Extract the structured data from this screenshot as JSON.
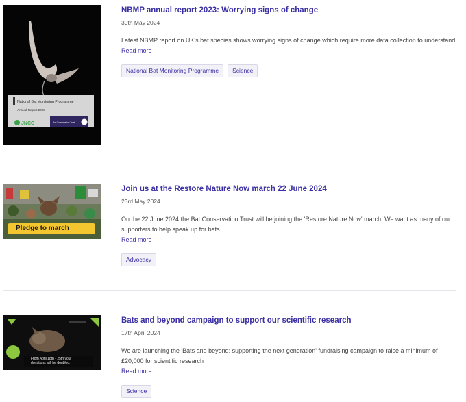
{
  "articles": [
    {
      "title": "NBMP annual report 2023: Worrying signs of change",
      "date": "30th May 2024",
      "summary": "Latest NBMP report on UK's bat species shows worrying signs of change which require more data collection to understand.",
      "read_more": "Read more",
      "tags": [
        "National Bat Monitoring Programme",
        "Science"
      ],
      "image": {
        "cover_title": "National Bat Monitoring Programme",
        "cover_subtitle": "Annual Report 2023",
        "logo_left": "JNCC",
        "logo_right": "Bat Conservation Trust"
      }
    },
    {
      "title": "Join us at the Restore Nature Now march 22 June 2024",
      "date": "23rd May 2024",
      "summary": "On the 22 June 2024 the Bat Conservation Trust will be joining the 'Restore Nature Now' march. We want as many of our supporters to help speak up for bats",
      "read_more": "Read more",
      "tags": [
        "Advocacy"
      ],
      "image": {
        "banner": "Pledge to march"
      }
    },
    {
      "title": "Bats and beyond campaign to support our scientific research",
      "date": "17th April 2024",
      "summary": "We are launching the 'Bats and beyond: supporting the next generation' fundraising campaign to raise a minimum of £20,000 for scientific research",
      "read_more": "Read more",
      "tags": [
        "Science"
      ],
      "image": {
        "caption_line1": "From April 18th - 25th your",
        "caption_line2": "donations will be doubled."
      }
    }
  ]
}
